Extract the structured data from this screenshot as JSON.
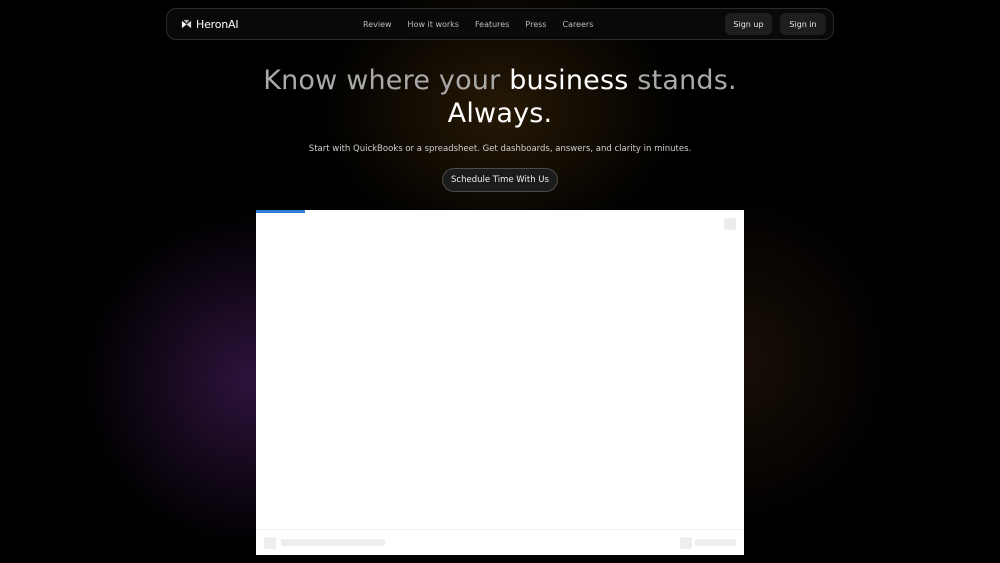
{
  "nav": {
    "brand": "HeronAI",
    "links": [
      "Review",
      "How it works",
      "Features",
      "Press",
      "Careers"
    ],
    "signup_label": "Sign up",
    "signin_label": "Sign in"
  },
  "hero": {
    "title_part1": "Know where your ",
    "title_part2": "business",
    "title_part3": " stands.",
    "title_line2": "Always.",
    "subtitle": "Start with QuickBooks or a spreadsheet. Get dashboards, answers, and clarity in minutes.",
    "cta_label": "Schedule Time With Us"
  },
  "embed": {
    "progress": 0.1
  },
  "icons": {
    "brand": "heron-logo-icon"
  },
  "colors": {
    "background": "#000000",
    "progress": "#2d7fd6"
  }
}
